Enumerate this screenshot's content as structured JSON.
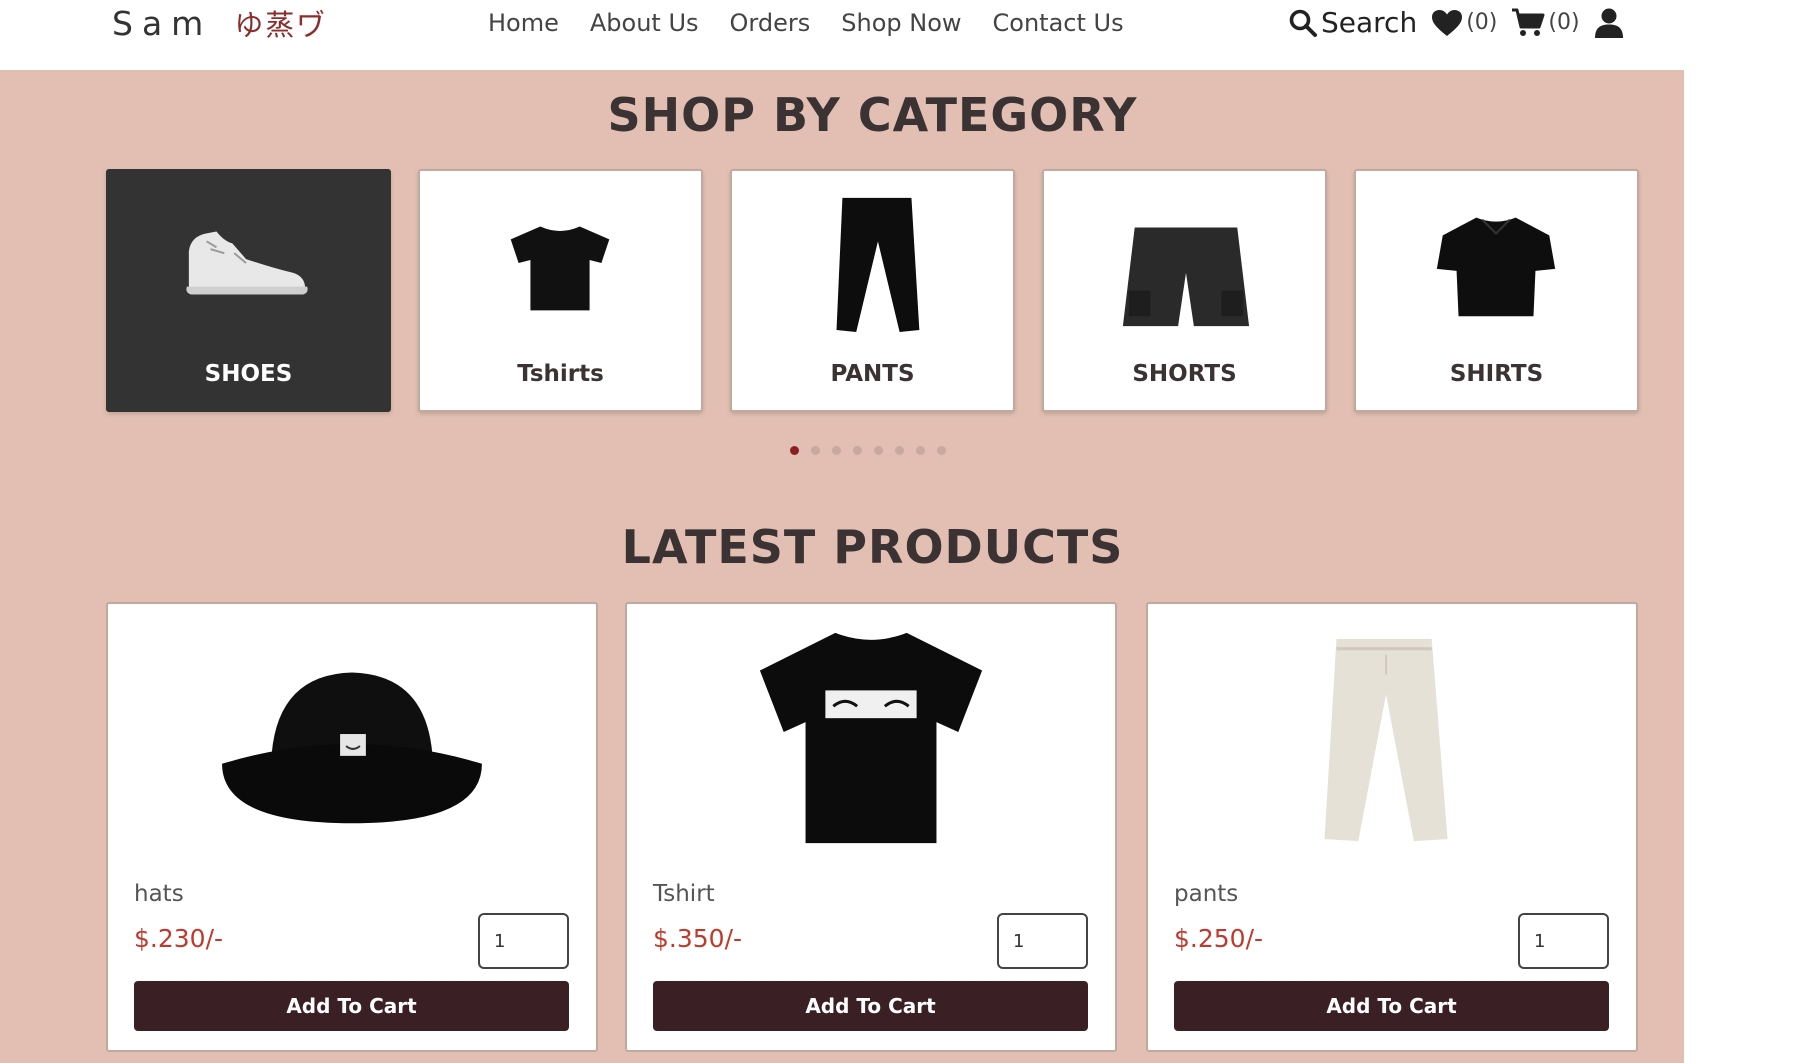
{
  "header": {
    "logo_text": "Sam",
    "logo_kana": "ゆ蒸ヷ",
    "nav": [
      "Home",
      "About Us",
      "Orders",
      "Shop Now",
      "Contact Us"
    ],
    "search_label": "Search",
    "wishlist_count": "(0)",
    "cart_count": "(0)"
  },
  "categories": {
    "title": "SHOP BY CATEGORY",
    "items": [
      {
        "label": "SHOES",
        "active": true
      },
      {
        "label": "Tshirts",
        "active": false
      },
      {
        "label": "PANTS",
        "active": false
      },
      {
        "label": "SHORTS",
        "active": false
      },
      {
        "label": "SHIRTS",
        "active": false
      }
    ],
    "carousel_pages": 8,
    "carousel_current": 1
  },
  "latest": {
    "title": "LATEST PRODUCTS",
    "products": [
      {
        "name": "hats",
        "price": "$.230/-",
        "qty": "1",
        "button": "Add To Cart"
      },
      {
        "name": "Tshirt",
        "price": "$.350/-",
        "qty": "1",
        "button": "Add To Cart"
      },
      {
        "name": "pants",
        "price": "$.250/-",
        "qty": "1",
        "button": "Add To Cart"
      }
    ]
  },
  "colors": {
    "page_bg": "#e2bfb2",
    "button_bg": "#3a1f25",
    "price": "#c0392b",
    "active_dot": "#8a1f1f",
    "active_card": "#333333"
  }
}
